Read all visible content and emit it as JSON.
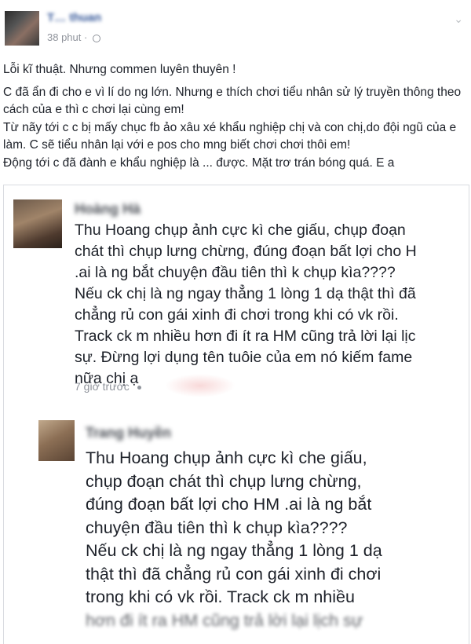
{
  "post": {
    "author": "T… thuan",
    "time": "38 phut ·",
    "paragraphs": [
      "Lỗi kĩ thuật. Nhưng commen luyên thuyên !",
      "C đã ẩn đi cho e vì lí do ng lớn. Nhưng e thích chơi tiểu nhân sử lý truyền thông theo cách của e thì c chơi lại cùng em!",
      "Từ nãy tới c c bị mấy chục fb ảo xâu xé khẩu nghiệp chị và con chị,do đội ngũ của e làm. C sẽ tiểu nhân lại với e pos cho mng biết chơi chơi thôi em!",
      "Động tới c đã đành e khẩu nghiệp là ... được. Mặt trơ trán bóng quá. E a"
    ]
  },
  "screenshot": {
    "comment1": {
      "name": "Hoàng Hà",
      "lines": [
        "Thu Hoang  chụp ảnh cực kì che giấu, chụp đoạn",
        "chát thì chụp lưng chừng, đúng đoạn bất lợi cho H",
        ".ai là ng bắt chuyện đầu tiên thì k chụp kìa????",
        "Nếu ck chị là ng ngay thẳng 1 lòng 1 dạ thật thì đã",
        "chẳng rủ con gái xinh đi chơi trong khi có vk rồi.",
        "Track ck m nhiều hơn đi ít ra HM cũng trả lời lại lịc",
        "sự. Đừng lợi dụng tên tuôie của em nó kiếm fame",
        "nữa chị ạ"
      ],
      "time": "7 giờ trước"
    },
    "comment2": {
      "name": "Trang Huyền",
      "lines": [
        "Thu Hoang  chụp ảnh cực kì che giấu,",
        "chụp đoạn chát thì chụp lưng chừng,",
        "đúng đoạn bất lợi cho HM .ai là ng bắt",
        "chuyện đầu tiên thì k chụp kìa????",
        "Nếu ck chị là ng ngay thẳng 1 lòng 1 dạ",
        "thật thì đã chẳng rủ con gái xinh đi chơi",
        "trong khi có vk rồi. Track ck m nhiều",
        "hơn đi ít ra HM cũng trả lời lại lịch sự"
      ]
    }
  },
  "icons": {
    "privacy": "globe-icon",
    "menu": "chevron-down-icon",
    "time_separator": "dot-icon"
  },
  "colors": {
    "link": "#365899",
    "meta": "#90949c",
    "text": "#1d2129"
  }
}
